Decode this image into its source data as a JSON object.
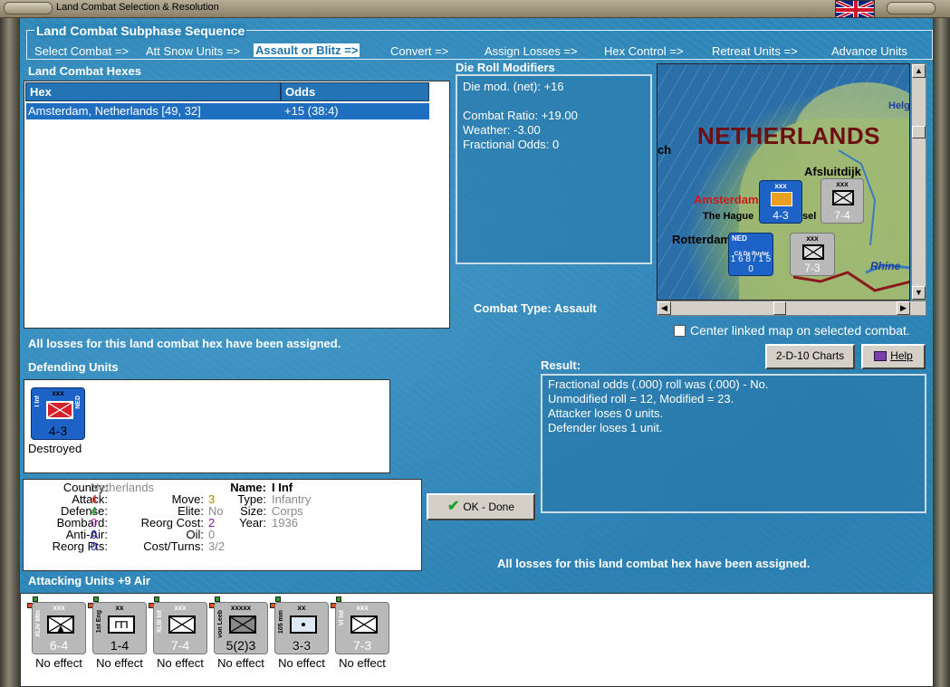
{
  "window": {
    "title": "Land Combat Selection & Resolution"
  },
  "subphase": {
    "title": "Land Combat Subphase Sequence",
    "steps": [
      "Select Combat =>",
      "Att Snow Units =>",
      "Assault or Blitz =>",
      "Convert =>",
      "Assign Losses =>",
      "Hex Control =>",
      "Retreat Units =>",
      "Advance Units"
    ],
    "active_index": 2
  },
  "hexes": {
    "title": "Land Combat Hexes",
    "col_hex": "Hex",
    "col_odds": "Odds",
    "rows": [
      {
        "hex": "Amsterdam, Netherlands [49, 32]",
        "odds": "+15 (38:4)"
      }
    ]
  },
  "drm": {
    "title": "Die Roll Modifiers",
    "lines": [
      "Die mod. (net): +16",
      "",
      "Combat Ratio: +19.00",
      "Weather: -3.00",
      "Fractional Odds: 0"
    ]
  },
  "combat_type": {
    "label": "Combat Type:",
    "value": "Assault"
  },
  "map": {
    "labels": {
      "country": "NETHERLANDS",
      "afsluitdijk": "Afsluitdijk",
      "amsterdam": "Amsterdam",
      "hague": "The Hague",
      "hague_tail": "sel",
      "rotterdam": "Rotterdam",
      "rhine": "Rhine",
      "helg": "Helg",
      "ch": "ch"
    },
    "counters": [
      {
        "top": "xxx",
        "side": "I Inf",
        "value": "4-3",
        "color": "#1d63c7"
      },
      {
        "top": "xxx",
        "side": "",
        "value": "7-4",
        "color": "#b9b9b9"
      },
      {
        "top": "NED",
        "side": "CA De Ruyter",
        "value": "1 6 8 / 1 5 0",
        "color": "#1d63c7"
      },
      {
        "top": "xxx",
        "side": "VI Inf",
        "value": "7-3",
        "color": "#b9b9b9"
      }
    ],
    "center_checkbox_label": "Center linked map on selected combat.",
    "center_checked": false
  },
  "status_message": "All losses for this land combat hex have been assigned.",
  "buttons": {
    "charts": "2-D-10 Charts",
    "help": "Help",
    "done": "OK - Done"
  },
  "defending": {
    "title": "Defending Units",
    "units": [
      {
        "size": "xxx",
        "name": "I Inf",
        "nation": "NED",
        "strength": "4-3",
        "status": "Destroyed"
      }
    ]
  },
  "unit_info": {
    "country_label": "Country:",
    "country": "Netherlands",
    "attack_label": "Attack:",
    "attack": "4",
    "defense_label": "Defense:",
    "defense": "4",
    "bombard_label": "Bombard:",
    "bombard": "0",
    "antiair_label": "Anti-Air:",
    "antiair": "0",
    "reorgpts_label": "Reorg Pts:",
    "reorgpts": "0",
    "move_label": "Move:",
    "move": "3",
    "elite_label": "Elite:",
    "elite": "No",
    "reorgcost_label": "Reorg Cost:",
    "reorgcost": "2",
    "oil_label": "Oil:",
    "oil": "0",
    "costturns_label": "Cost/Turns:",
    "costturns": "3/2",
    "name_label": "Name:",
    "name": "I Inf",
    "type_label": "Type:",
    "type": "Infantry",
    "size_label": "Size:",
    "size": "Corps",
    "year_label": "Year:",
    "year": "1936",
    "colors": {
      "attack": "#e0201a",
      "defense": "#1a9a22",
      "bombard": "#c020c0",
      "antiair": "#2020d0",
      "reorgpts": "#2020d0",
      "move": "#b08a00",
      "reorgcost": "#8020a0",
      "muted": "#8a8a8a"
    }
  },
  "result": {
    "title": "Result:",
    "lines": [
      "Fractional odds (.000) roll was (.000)  - No.",
      "Unmodified roll = 12, Modified = 23.",
      "Attacker loses 0 units.",
      "Defender loses 1 unit."
    ]
  },
  "attacking": {
    "title": "Attacking Units +9 Air",
    "units": [
      {
        "size": "xxx",
        "name": "XLIV Mtn",
        "strength": "6-4",
        "status": "No effect",
        "symbol": "mountain"
      },
      {
        "size": "xx",
        "name": "1st Eng",
        "strength": "1-4",
        "status": "No effect",
        "symbol": "engineer"
      },
      {
        "size": "xxx",
        "name": "XLIII Inf",
        "strength": "7-4",
        "status": "No effect",
        "symbol": "infantry"
      },
      {
        "size": "xxxxx",
        "name": "von Leeb",
        "strength": "5(2)3",
        "status": "No effect",
        "symbol": "hq"
      },
      {
        "size": "xx",
        "name": "105 mm",
        "strength": "3-3",
        "status": "No effect",
        "symbol": "artillery"
      },
      {
        "size": "xxx",
        "name": "VI Inf",
        "strength": "7-3",
        "status": "No effect",
        "symbol": "infantry"
      }
    ]
  }
}
